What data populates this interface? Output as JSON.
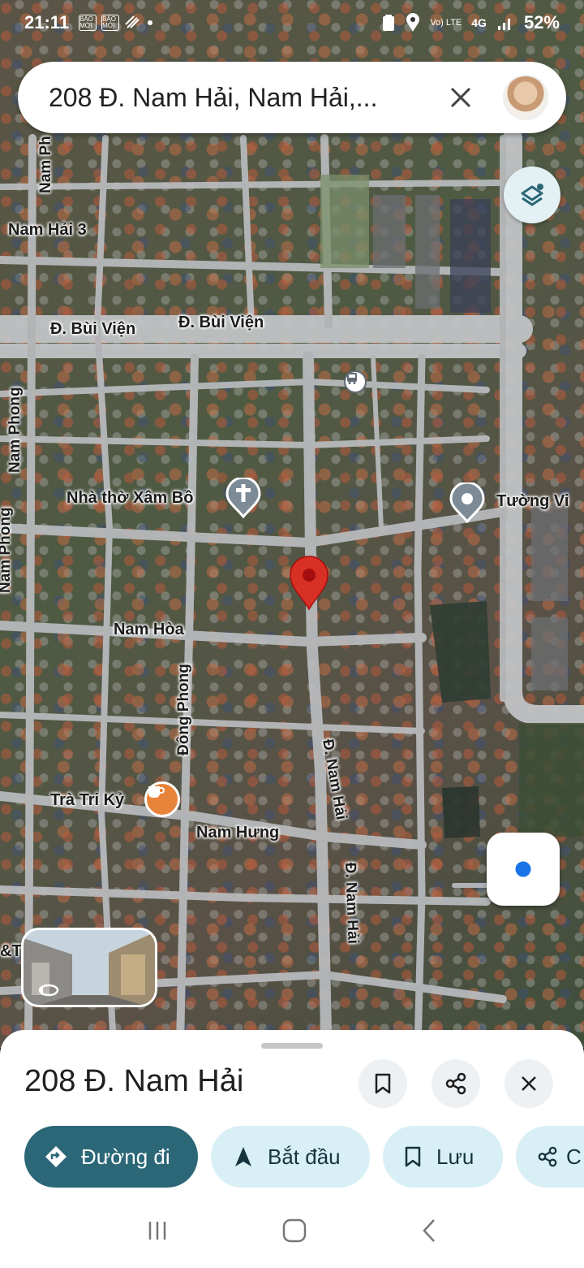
{
  "status_bar": {
    "time": "21:11",
    "badges": [
      "BÁO MỚI",
      "BÁO MỚI"
    ],
    "network": "4G",
    "volte": "Vo) LTE",
    "battery": "52%"
  },
  "search": {
    "query": "208 Đ. Nam Hải, Nam Hải,..."
  },
  "map": {
    "labels": {
      "nam_hai_3": "Nam Hải 3",
      "nam_phong_top": "Nam Ph",
      "bui_vien_left": "Đ. Bùi Viện",
      "bui_vien_right": "Đ. Bùi Viện",
      "nam_phong_mid": "Nam Phong",
      "nam_phong_low": "Nam Phong",
      "church": "Nhà thờ Xâm Bồ",
      "tuong_vi": "Tường Vi",
      "nam_hoa": "Nam Hòa",
      "dong_phong": "Đông Phong",
      "nam_hai_upper": "Đ. Nam Hải",
      "nam_hai_lower": "Đ. Nam Hải",
      "tra_tri_ky": "Trà Tri Kỷ",
      "nam_hung": "Nam Hưng",
      "edge_left": "&T"
    },
    "icons": {
      "pin": "red-location-pin",
      "church": "church-cross-icon",
      "poi": "place-icon",
      "cafe": "coffee-cup-icon",
      "bus": "bus-stop-icon"
    },
    "colors": {
      "pin": "#d93025",
      "poi_badge": "#7d8b96",
      "cafe_badge": "#e8833a"
    }
  },
  "sheet": {
    "title": "208 Đ. Nam Hải",
    "actions": {
      "directions": "Đường đi",
      "start": "Bắt đầu",
      "save": "Lưu",
      "share_partial": "C"
    },
    "colors": {
      "primary_chip": "#2b6777",
      "secondary_chip": "#d8eff6"
    }
  }
}
